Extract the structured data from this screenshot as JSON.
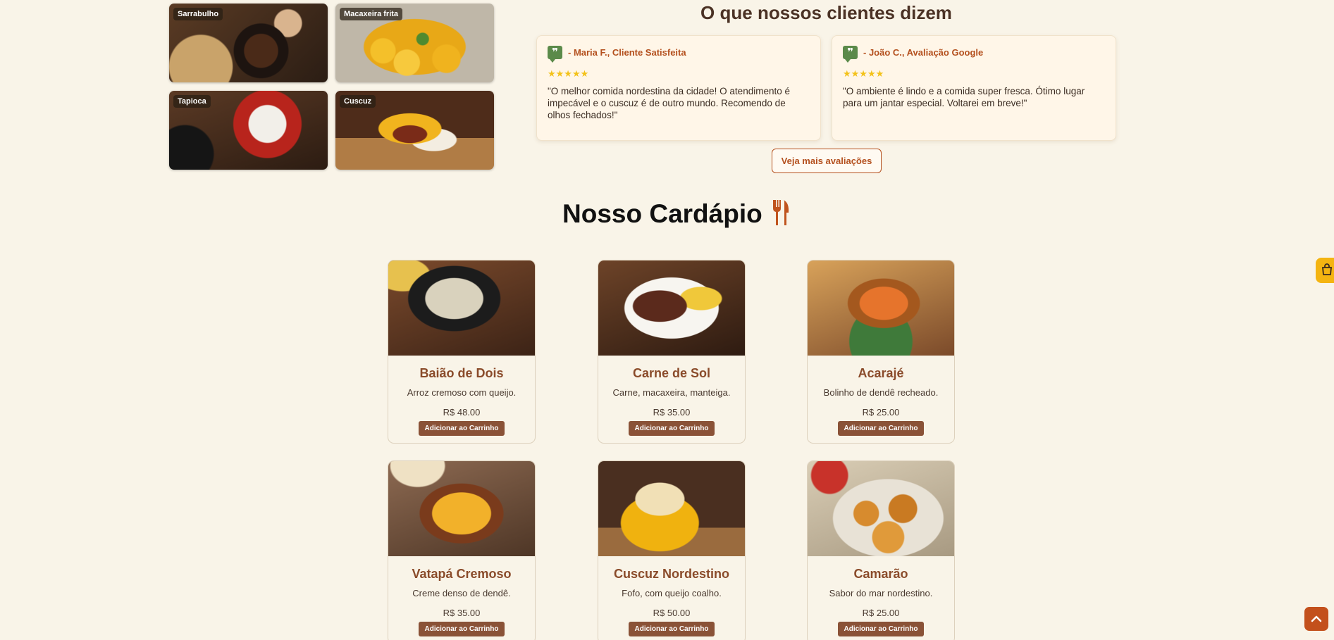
{
  "gallery": [
    {
      "label": "Sarrabulho"
    },
    {
      "label": "Macaxeira frita"
    },
    {
      "label": "Tapioca"
    },
    {
      "label": "Cuscuz"
    }
  ],
  "testimonials": {
    "title": "O que nossos clientes dizem",
    "reviews": [
      {
        "author": "- Maria F., Cliente Satisfeita",
        "stars": "★★★★★",
        "text": "\"O melhor comida nordestina da cidade! O atendimento é impecável e o cuscuz é de outro mundo. Recomendo de olhos fechados!\""
      },
      {
        "author": "- João C., Avaliação Google",
        "stars": "★★★★★",
        "text": "\"O ambiente é lindo e a comida super fresca. Ótimo lugar para um jantar especial. Voltarei em breve!\""
      }
    ],
    "more_label": "Veja mais avaliações"
  },
  "menu": {
    "title": "Nosso Cardápio",
    "add_label": "Adicionar ao Carrinho",
    "items": [
      {
        "name": "Baião de Dois",
        "desc": "Arroz cremoso com queijo.",
        "price": "R$ 48.00"
      },
      {
        "name": "Carne de Sol",
        "desc": "Carne, macaxeira, manteiga.",
        "price": "R$ 35.00"
      },
      {
        "name": "Acarajé",
        "desc": "Bolinho de dendê recheado.",
        "price": "R$ 25.00"
      },
      {
        "name": "Vatapá Cremoso",
        "desc": "Creme denso de dendê.",
        "price": "R$ 35.00"
      },
      {
        "name": "Cuscuz Nordestino",
        "desc": "Fofo, com queijo coalho.",
        "price": "R$ 50.00"
      },
      {
        "name": "Camarão",
        "desc": "Sabor do mar nordestino.",
        "price": "R$ 25.00"
      }
    ]
  },
  "colors": {
    "background": "#f9f4e8",
    "accent": "#b4501e",
    "button": "#8a5237",
    "star": "#f3c21a",
    "cart": "#f4b411"
  },
  "icons": {
    "quote": "quote-icon",
    "utensils": "utensils-icon",
    "cart": "cart-icon",
    "scroll_top": "chevron-up-icon"
  }
}
